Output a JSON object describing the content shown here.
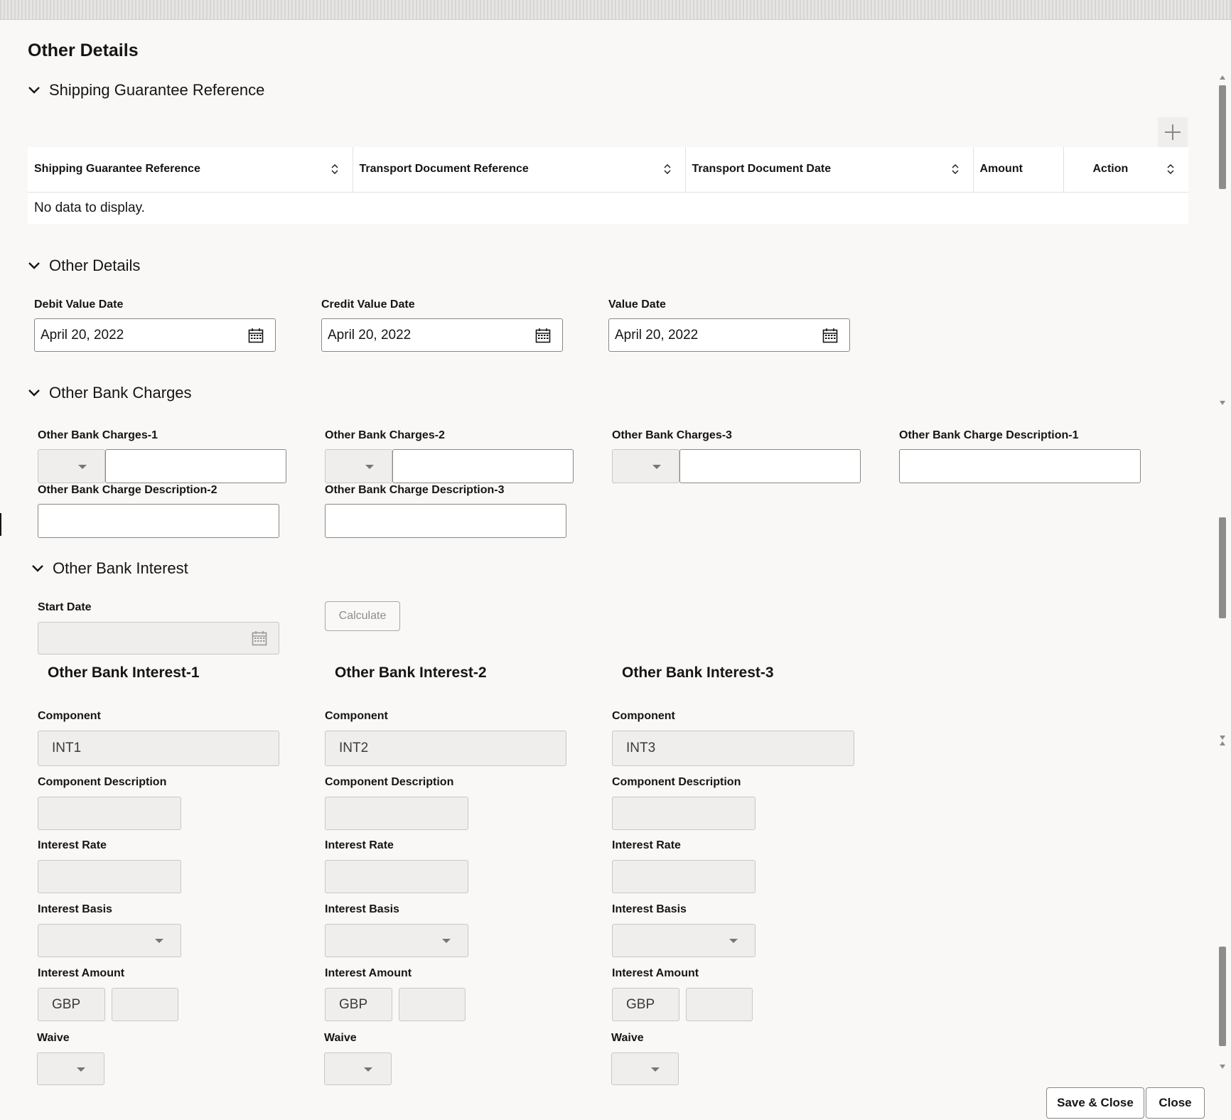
{
  "page_title": "Other Details",
  "shipping_guarantee": {
    "section_title": "Shipping Guarantee Reference",
    "columns": [
      "Shipping Guarantee Reference",
      "Transport Document Reference",
      "Transport Document Date",
      "Amount",
      "Action"
    ],
    "empty_message": "No data to display."
  },
  "other_details": {
    "section_title": "Other Details",
    "fields": [
      {
        "label": "Debit Value Date",
        "value": "April 20, 2022"
      },
      {
        "label": "Credit Value Date",
        "value": "April 20, 2022"
      },
      {
        "label": "Value Date",
        "value": "April 20, 2022"
      }
    ]
  },
  "other_bank_charges": {
    "section_title": "Other Bank Charges",
    "charges": [
      {
        "label": "Other Bank Charges-1"
      },
      {
        "label": "Other Bank Charges-2"
      },
      {
        "label": "Other Bank Charges-3"
      }
    ],
    "descriptions": [
      {
        "label": "Other Bank Charge Description-1"
      },
      {
        "label": "Other Bank Charge Description-2"
      },
      {
        "label": "Other Bank Charge Description-3"
      }
    ]
  },
  "other_bank_interest": {
    "section_title": "Other Bank Interest",
    "start_date_label": "Start Date",
    "calculate_label": "Calculate",
    "columns": [
      {
        "title": "Other Bank Interest-1",
        "component_label": "Component",
        "component_value": "INT1",
        "component_desc_label": "Component Description",
        "rate_label": "Interest Rate",
        "basis_label": "Interest Basis",
        "amount_label": "Interest Amount",
        "currency": "GBP",
        "waive_label": "Waive"
      },
      {
        "title": "Other Bank Interest-2",
        "component_label": "Component",
        "component_value": "INT2",
        "component_desc_label": "Component Description",
        "rate_label": "Interest Rate",
        "basis_label": "Interest Basis",
        "amount_label": "Interest Amount",
        "currency": "GBP",
        "waive_label": "Waive"
      },
      {
        "title": "Other Bank Interest-3",
        "component_label": "Component",
        "component_value": "INT3",
        "component_desc_label": "Component Description",
        "rate_label": "Interest Rate",
        "basis_label": "Interest Basis",
        "amount_label": "Interest Amount",
        "currency": "GBP",
        "waive_label": "Waive"
      }
    ]
  },
  "footer": {
    "save_close_label": "Save & Close",
    "close_label": "Close"
  }
}
